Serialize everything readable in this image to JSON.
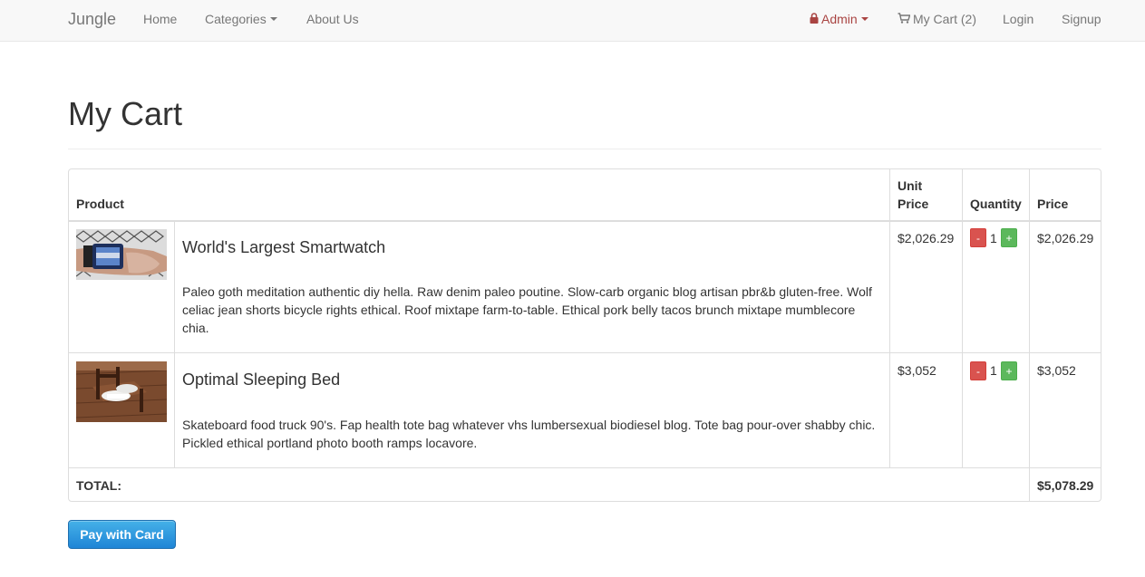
{
  "navbar": {
    "brand": "Jungle",
    "home": "Home",
    "categories": "Categories",
    "about": "About Us",
    "admin": "Admin",
    "cart": "My Cart (2)",
    "login": "Login",
    "signup": "Signup"
  },
  "page": {
    "title": "My Cart"
  },
  "table": {
    "headers": {
      "product": "Product",
      "unit_price_line1": "Unit",
      "unit_price_line2": "Price",
      "quantity": "Quantity",
      "price": "Price"
    },
    "rows": [
      {
        "name": "World's Largest Smartwatch",
        "description": "Paleo goth meditation authentic diy hella. Raw denim paleo poutine. Slow-carb organic blog artisan pbr&b gluten-free. Wolf celiac jean shorts bicycle rights ethical. Roof mixtape farm-to-table. Ethical pork belly tacos brunch mixtape mumblecore chia.",
        "unit_price": "$2,026.29",
        "quantity": "1",
        "price": "$2,026.29",
        "image": "smartwatch-photo"
      },
      {
        "name": "Optimal Sleeping Bed",
        "description": "Skateboard food truck 90's. Fap health tote bag whatever vhs lumbersexual biodiesel blog. Tote bag pour-over shabby chic. Pickled ethical portland photo booth ramps locavore.",
        "unit_price": "$3,052",
        "quantity": "1",
        "price": "$3,052",
        "image": "bed-photo"
      }
    ],
    "total_label": "TOTAL:",
    "total_value": "$5,078.29",
    "minus_label": "-",
    "plus_label": "+"
  },
  "pay_button": "Pay with Card",
  "colors": {
    "admin": "#a94442",
    "minus": "#d9534f",
    "plus": "#5cb85c",
    "pay": "#1f85d6"
  }
}
